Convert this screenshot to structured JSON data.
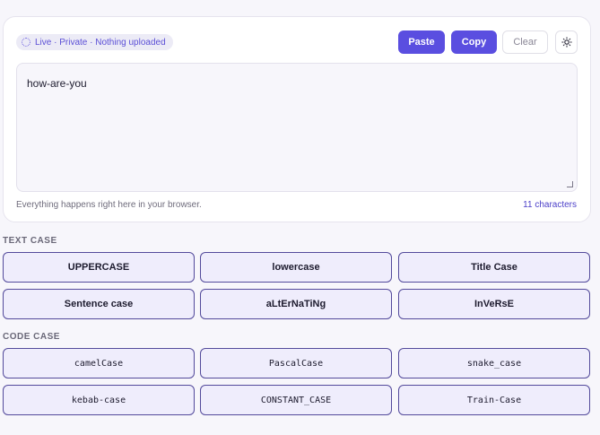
{
  "status": {
    "text": "Live · Private · Nothing uploaded"
  },
  "toolbar": {
    "paste": "Paste",
    "copy": "Copy",
    "clear": "Clear",
    "theme_icon": "sun-icon"
  },
  "editor": {
    "value": "how-are-you"
  },
  "helper": "Everything happens right here in your browser.",
  "charcount": "11 characters",
  "text_case": {
    "heading": "TEXT CASE",
    "buttons": [
      "UPPERCASE",
      "lowercase",
      "Title Case",
      "Sentence case",
      "aLtErNaTiNg",
      "InVeRsE"
    ]
  },
  "code_case": {
    "heading": "CODE CASE",
    "buttons": [
      "camelCase",
      "PascalCase",
      "snake_case",
      "kebab-case",
      "CONSTANT_CASE",
      "Train-Case"
    ]
  },
  "colors": {
    "accent": "#5a4ee0",
    "button_bg": "#efedfc",
    "button_border": "#534a9b"
  }
}
